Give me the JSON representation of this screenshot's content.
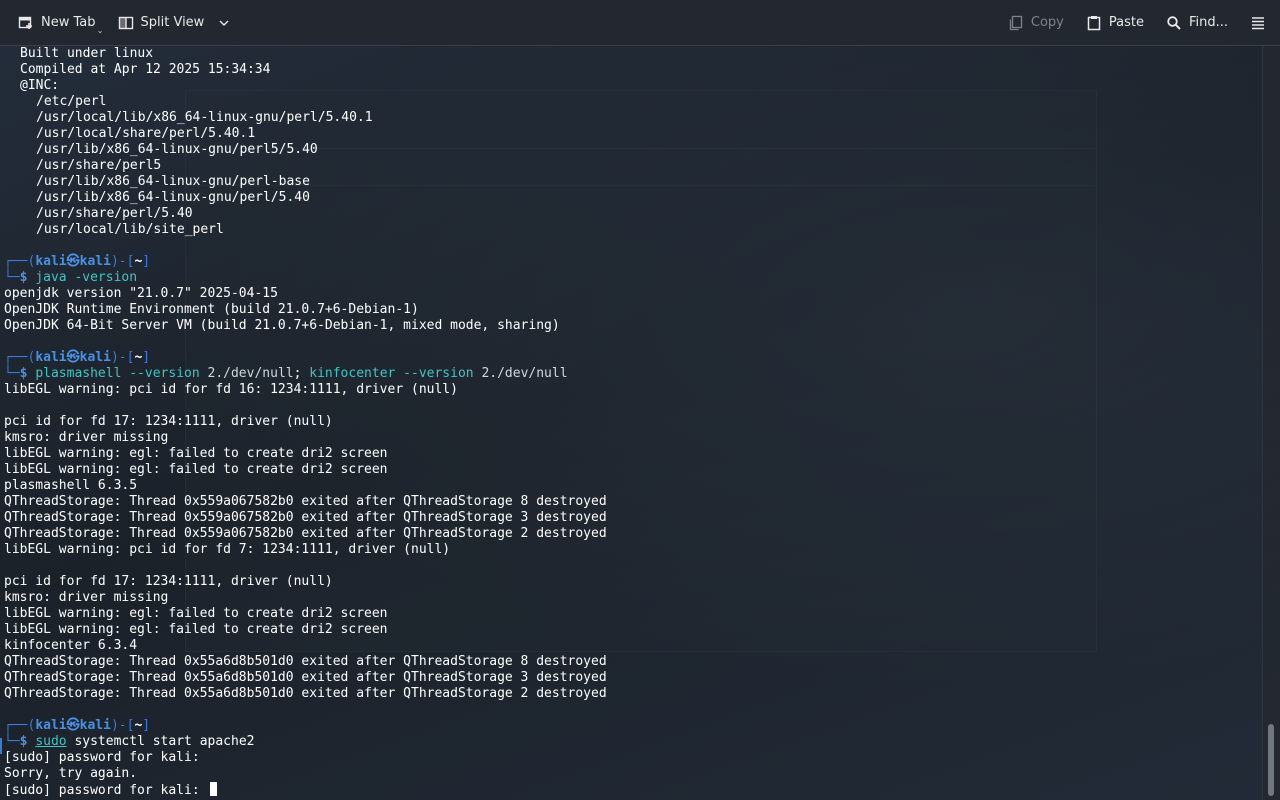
{
  "toolbar": {
    "new_tab": "New Tab",
    "split_view": "Split View",
    "copy": "Copy",
    "paste": "Paste",
    "find": "Find..."
  },
  "colors": {
    "prompt_frame": "#3a7bd5",
    "user": "#4a90e2",
    "command": "#41c4c4",
    "background": "#1f252e"
  },
  "perl_section": {
    "built": "Built under linux",
    "compiled": "Compiled at Apr 12 2025 15:34:34",
    "inc_label": "@INC:",
    "inc_paths": [
      "/etc/perl",
      "/usr/local/lib/x86_64-linux-gnu/perl/5.40.1",
      "/usr/local/share/perl/5.40.1",
      "/usr/lib/x86_64-linux-gnu/perl5/5.40",
      "/usr/share/perl5",
      "/usr/lib/x86_64-linux-gnu/perl-base",
      "/usr/lib/x86_64-linux-gnu/perl/5.40",
      "/usr/share/perl/5.40",
      "/usr/local/lib/site_perl"
    ]
  },
  "prompt": {
    "top_prefix": "┌──(",
    "user": "kali",
    "at": "㉿",
    "host": "kali",
    "mid": ")-[",
    "dir": "~",
    "end": "]",
    "bottom_prefix": "└─",
    "dollar": "$"
  },
  "block_java": {
    "cmd": "java",
    "args": " -version",
    "output": [
      "openjdk version \"21.0.7\" 2025-04-15",
      "OpenJDK Runtime Environment (build 21.0.7+6-Debian-1)",
      "OpenJDK 64-Bit Server VM (build 21.0.7+6-Debian-1, mixed mode, sharing)"
    ]
  },
  "block_plasma": {
    "cmd1": "plasmashell",
    "args1": " --version ",
    "redir1": "2./dev/null",
    "sep": "; ",
    "cmd2": "kinfocenter",
    "args2": " --version ",
    "redir2": "2./dev/null",
    "output_a": [
      "libEGL warning: pci id for fd 16: 1234:1111, driver (null)",
      "",
      "pci id for fd 17: 1234:1111, driver (null)",
      "kmsro: driver missing",
      "libEGL warning: egl: failed to create dri2 screen",
      "libEGL warning: egl: failed to create dri2 screen",
      "plasmashell 6.3.5",
      "QThreadStorage: Thread 0x559a067582b0 exited after QThreadStorage 8 destroyed",
      "QThreadStorage: Thread 0x559a067582b0 exited after QThreadStorage 3 destroyed",
      "QThreadStorage: Thread 0x559a067582b0 exited after QThreadStorage 2 destroyed",
      "libEGL warning: pci id for fd 7: 1234:1111, driver (null)",
      "",
      "pci id for fd 17: 1234:1111, driver (null)",
      "kmsro: driver missing",
      "libEGL warning: egl: failed to create dri2 screen",
      "libEGL warning: egl: failed to create dri2 screen",
      "kinfocenter 6.3.4",
      "QThreadStorage: Thread 0x55a6d8b501d0 exited after QThreadStorage 8 destroyed",
      "QThreadStorage: Thread 0x55a6d8b501d0 exited after QThreadStorage 3 destroyed",
      "QThreadStorage: Thread 0x55a6d8b501d0 exited after QThreadStorage 2 destroyed"
    ]
  },
  "block_apache": {
    "sudo": "sudo",
    "cmd": " systemctl",
    "args": " start apache2",
    "output": [
      "[sudo] password for kali:",
      "Sorry, try again."
    ],
    "current": "[sudo] password for kali: "
  }
}
